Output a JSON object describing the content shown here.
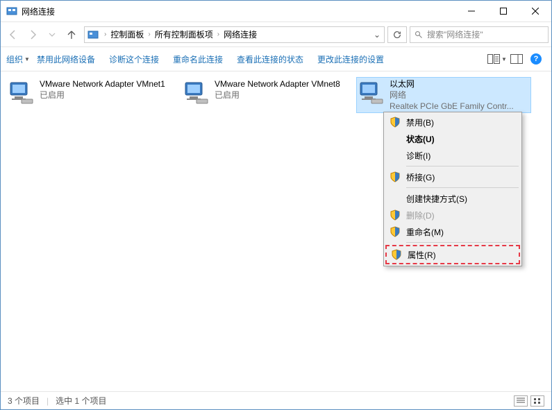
{
  "window": {
    "title": "网络连接"
  },
  "breadcrumb": {
    "parts": [
      "控制面板",
      "所有控制面板项",
      "网络连接"
    ]
  },
  "search": {
    "placeholder": "搜索\"网络连接\""
  },
  "toolbar": {
    "organize": "组织",
    "items": [
      "禁用此网络设备",
      "诊断这个连接",
      "重命名此连接",
      "查看此连接的状态",
      "更改此连接的设置"
    ]
  },
  "adapters": [
    {
      "name": "VMware Network Adapter VMnet1",
      "status": "已启用",
      "desc": ""
    },
    {
      "name": "VMware Network Adapter VMnet8",
      "status": "已启用",
      "desc": ""
    },
    {
      "name": "以太网",
      "status": "网络",
      "desc": "Realtek PCIe GbE Family Contr..."
    }
  ],
  "context_menu": {
    "disable": "禁用(B)",
    "status": "状态(U)",
    "diagnose": "诊断(I)",
    "bridge": "桥接(G)",
    "shortcut": "创建快捷方式(S)",
    "delete": "删除(D)",
    "rename": "重命名(M)",
    "properties": "属性(R)"
  },
  "statusbar": {
    "count": "3 个项目",
    "selected": "选中 1 个项目"
  }
}
